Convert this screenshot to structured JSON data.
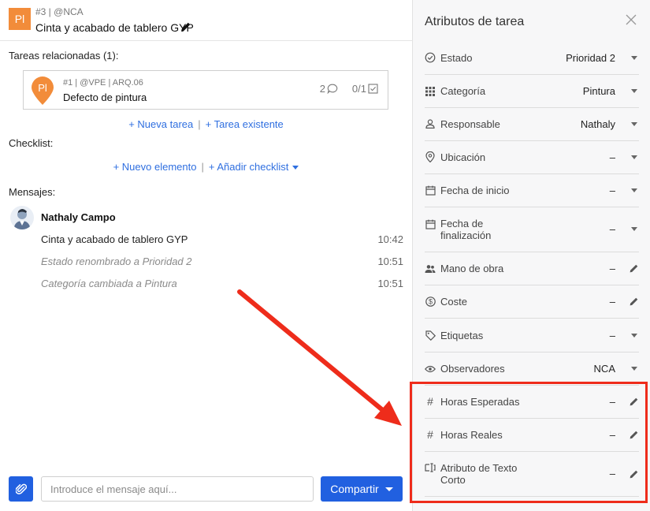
{
  "header": {
    "badge": "Pl",
    "ref": "#3 | @NCA",
    "title": "Cinta y acabado de tablero GYP"
  },
  "related": {
    "label": "Tareas relacionadas (1):",
    "card": {
      "badge": "Pl",
      "ref": "#1 | @VPE | ARQ.06",
      "title": "Defecto de pintura",
      "comments": "2",
      "checklist": "0/1"
    },
    "new_task": "+ Nueva tarea",
    "existing_task": "+ Tarea existente"
  },
  "checklist": {
    "label": "Checklist:",
    "new_item": "+ Nuevo elemento",
    "add_checklist": "+ Añadir checklist"
  },
  "messages": {
    "label": "Mensajes:",
    "author": "Nathaly Campo",
    "items": [
      {
        "text": "Cinta y acabado de tablero GYP",
        "time": "10:42"
      },
      {
        "text": "Estado renombrado a Prioridad 2",
        "time": "10:51"
      },
      {
        "text": "Categoría cambiada a Pintura",
        "time": "10:51"
      }
    ]
  },
  "composer": {
    "placeholder": "Introduce el mensaje aquí...",
    "share": "Compartir"
  },
  "panel": {
    "title": "Atributos de tarea",
    "attributes": [
      {
        "label": "Estado",
        "value": "Prioridad 2",
        "icon": "check-circle-icon",
        "action": "dropdown"
      },
      {
        "label": "Categoría",
        "value": "Pintura",
        "icon": "grid-icon",
        "action": "dropdown"
      },
      {
        "label": "Responsable",
        "value": "Nathaly",
        "icon": "user-icon",
        "action": "dropdown"
      },
      {
        "label": "Ubicación",
        "value": "–",
        "icon": "location-pin-icon",
        "action": "dropdown"
      },
      {
        "label": "Fecha de inicio",
        "value": "–",
        "icon": "calendar-icon",
        "action": "dropdown"
      },
      {
        "label": "Fecha de",
        "label2": "finalización",
        "value": "–",
        "icon": "calendar-icon",
        "action": "dropdown"
      },
      {
        "label": "Mano de obra",
        "value": "–",
        "icon": "people-icon",
        "action": "edit"
      },
      {
        "label": "Coste",
        "value": "–",
        "icon": "dollar-icon",
        "action": "edit"
      },
      {
        "label": "Etiquetas",
        "value": "–",
        "icon": "tag-icon",
        "action": "dropdown"
      },
      {
        "label": "Observadores",
        "value": "NCA",
        "icon": "eye-icon",
        "action": "dropdown"
      },
      {
        "label": "Horas Esperadas",
        "value": "–",
        "icon": "hash-icon",
        "action": "edit"
      },
      {
        "label": "Horas Reales",
        "value": "–",
        "icon": "hash-icon",
        "action": "edit"
      },
      {
        "label": "Atributo de Texto",
        "label2": "Corto",
        "value": "–",
        "icon": "text-field-icon",
        "action": "edit"
      }
    ]
  },
  "colors": {
    "accent": "#2160e0",
    "link": "#2f6fe0",
    "badge": "#f28c3a",
    "highlight": "#ee2c1b"
  }
}
